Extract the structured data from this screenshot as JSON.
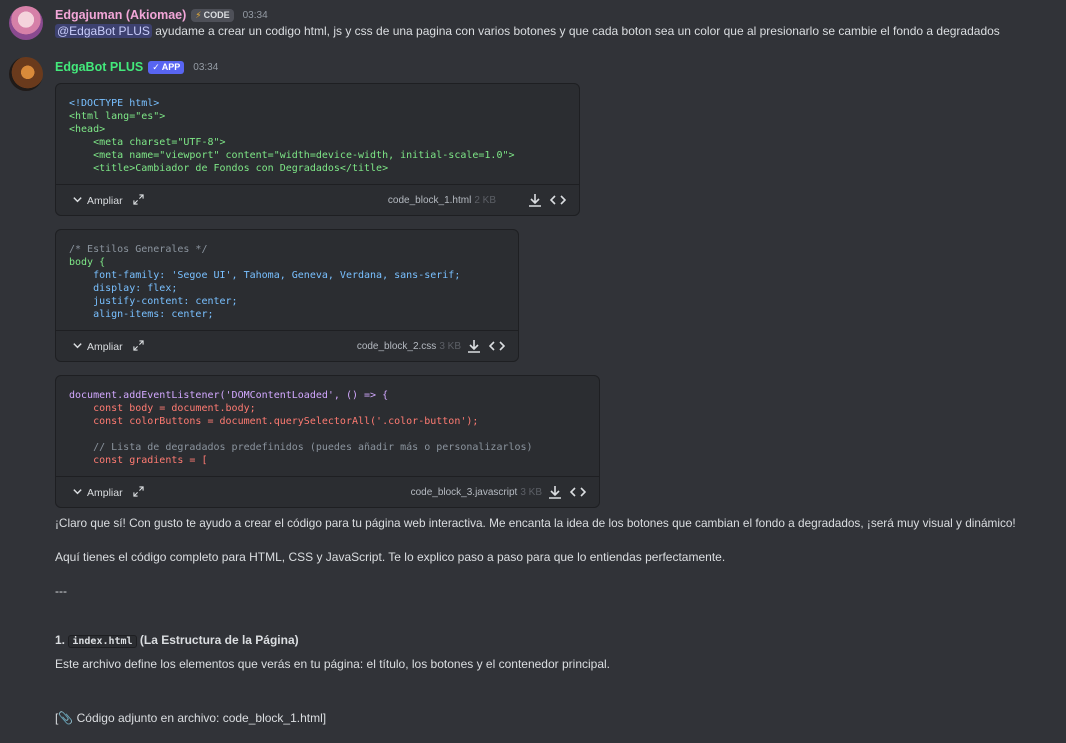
{
  "messages": [
    {
      "username": "Edgajuman (Akiomae)",
      "username_color": "#f2a6d8",
      "badge": "CODE",
      "time": "03:34",
      "mention": "@EdgaBot PLUS",
      "text": "ayudame a crear un codigo html, js y css de una pagina con varios botones y que cada boton sea un color que al presionarlo se cambie el fondo a degradados"
    },
    {
      "username": "EdgaBot PLUS",
      "username_color": "#43e97b",
      "badge": "APP",
      "time": "03:34"
    }
  ],
  "code_blocks": [
    {
      "lines": [
        "<!DOCTYPE html>",
        "<html lang=\"es\">",
        "<head>",
        "    <meta charset=\"UTF-8\">",
        "    <meta name=\"viewport\" content=\"width=device-width, initial-scale=1.0\">",
        "    <title>Cambiador de Fondos con Degradados</title>"
      ],
      "expand_label": "Ampliar",
      "filename": "code_block_1.html",
      "size": "2 KB"
    },
    {
      "lines": [
        "/* Estilos Generales */",
        "body {",
        "    font-family: 'Segoe UI', Tahoma, Geneva, Verdana, sans-serif;",
        "    display: flex;",
        "    justify-content: center;",
        "    align-items: center;"
      ],
      "expand_label": "Ampliar",
      "filename": "code_block_2.css",
      "size": "3 KB"
    },
    {
      "lines": [
        "document.addEventListener('DOMContentLoaded', () => {",
        "    const body = document.body;",
        "    const colorButtons = document.querySelectorAll('.color-button');",
        "",
        "    // Lista de degradados predefinidos (puedes añadir más o personalizarlos)",
        "    const gradients = ["
      ],
      "expand_label": "Ampliar",
      "filename": "code_block_3.javascript",
      "size": "3 KB"
    }
  ],
  "response": {
    "p1": "¡Claro que sí! Con gusto te ayudo a crear el código para tu página web interactiva. Me encanta la idea de los botones que cambian el fondo a degradados, ¡será muy visual y dinámico!",
    "p2": "Aquí tienes el código completo para HTML, CSS y JavaScript. Te lo explico paso a paso para que lo entiendas perfectamente.",
    "separator": "---",
    "heading_num": "1.",
    "heading_code": "index.html",
    "heading_rest": "(La Estructura de la Página)",
    "p3": "Este archivo define los elementos que verás en tu página: el título, los botones y el contenedor principal.",
    "attachment": "[📎 Código adjunto en archivo: code_block_1.html]"
  },
  "icons": [
    "chevron-down-icon",
    "expand-icon",
    "download-icon",
    "code-icon",
    "bolt-icon",
    "check-icon"
  ]
}
